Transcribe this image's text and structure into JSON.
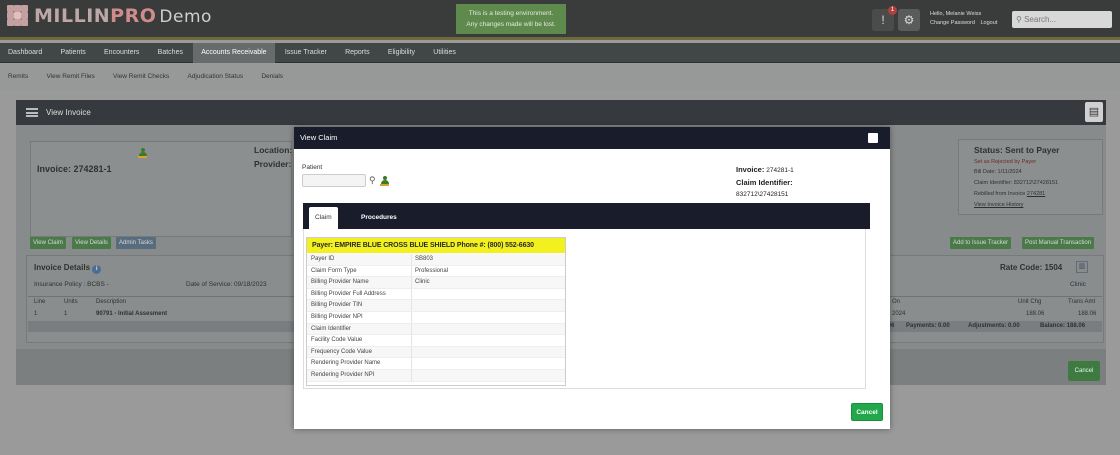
{
  "header": {
    "brand": "MILLIN",
    "brand_pro": "PRO",
    "brand_suffix": "Demo",
    "test_banner_line1": "This is a testing environment.",
    "test_banner_line2": "Any changes made will be lost.",
    "alert_count": "1",
    "greeting": "Hello, Melanie Weiss",
    "change_password": "Change Password",
    "logout": "Logout",
    "search_placeholder": "Search..."
  },
  "nav": {
    "items": [
      "Dashboard",
      "Patients",
      "Encounters",
      "Batches",
      "Accounts Receivable",
      "Issue Tracker",
      "Reports",
      "Eligibility",
      "Utilities"
    ],
    "active": "Accounts Receivable"
  },
  "subnav": {
    "items": [
      "Remits",
      "View Remit Files",
      "View Remit Checks",
      "Adjudication Status",
      "Denials"
    ]
  },
  "background": {
    "panel_title": "View Invoice",
    "invoice_label": "Invoice: 274281-1",
    "location_label": "Location:",
    "provider_label": "Provider:",
    "status_title": "Status: Sent to Payer",
    "set_rejected": "Set as Rejected by Payer",
    "bill_date": "Bill Date: 1/11/2024",
    "claim_identifier": "Claim Identifier: 832712\\27428151",
    "rebilled_from": "Rebilled from Invoice",
    "rebilled_invoice": "274281",
    "view_history": "View Invoice History",
    "btn_view_claim": "View Claim",
    "btn_view_details": "View Details",
    "btn_admin_tasks": "Admin Tasks",
    "btn_add_issue": "Add to Issue Tracker",
    "btn_post_manual": "Post Manual Transaction",
    "invoice_details": "Invoice Details",
    "rate_code": "Rate Code: 1504",
    "insurance_policy": "Insurance Policy : BCBS -",
    "date_of_service": "Date of Service: 09/18/2023",
    "clinic": "Clinic",
    "col_line": "Line",
    "col_units": "Units",
    "col_description": "Description",
    "col_on": "On",
    "col_unit_chg": "Unit Chg",
    "col_trans_amt": "Trans Amt",
    "row_line": "1",
    "row_units": "1",
    "row_description": "90791 - Initial Assesment",
    "row_year": "2024",
    "row_unit_chg": "188.06",
    "row_trans_amt": "188.06",
    "totals_prefix": ".06",
    "payments": "Payments: 0.00",
    "adjustments": "Adjustments: 0.00",
    "balance": "Balance: 188.06",
    "cancel": "Cancel"
  },
  "modal": {
    "title": "View Claim",
    "patient_label": "Patient",
    "invoice_label": "Invoice:",
    "invoice_value": "274281-1",
    "claim_identifier_label": "Claim Identifier:",
    "claim_identifier_value": "832712\\27428151",
    "tabs": [
      "Claim",
      "Procedures"
    ],
    "active_tab": "Claim",
    "payer_bar": "Payer: EMPIRE BLUE CROSS BLUE SHIELD    Phone #: (800) 552-6630",
    "fields": [
      {
        "key": "Payer ID",
        "value": "SB803"
      },
      {
        "key": "Claim Form Type",
        "value": "Professional"
      },
      {
        "key": "Billing Provider Name",
        "value": "Clinic"
      },
      {
        "key": "Billing Provider Full Address",
        "value": ""
      },
      {
        "key": "Billing Provider TIN",
        "value": ""
      },
      {
        "key": "Billing Provider NPI",
        "value": ""
      },
      {
        "key": "Claim Identifier",
        "value": ""
      },
      {
        "key": "Facility Code Value",
        "value": ""
      },
      {
        "key": "Frequency Code Value",
        "value": ""
      },
      {
        "key": "Rendering Provider Name",
        "value": ""
      },
      {
        "key": "Rendering Provider NPI",
        "value": ""
      }
    ],
    "cancel": "Cancel"
  },
  "colors": {
    "header_bg": "#3a3c3c",
    "modal_header": "#191d2b",
    "payer_highlight": "#f3f020",
    "cancel_green": "#22a84a",
    "test_banner": "#5f8a4e"
  }
}
